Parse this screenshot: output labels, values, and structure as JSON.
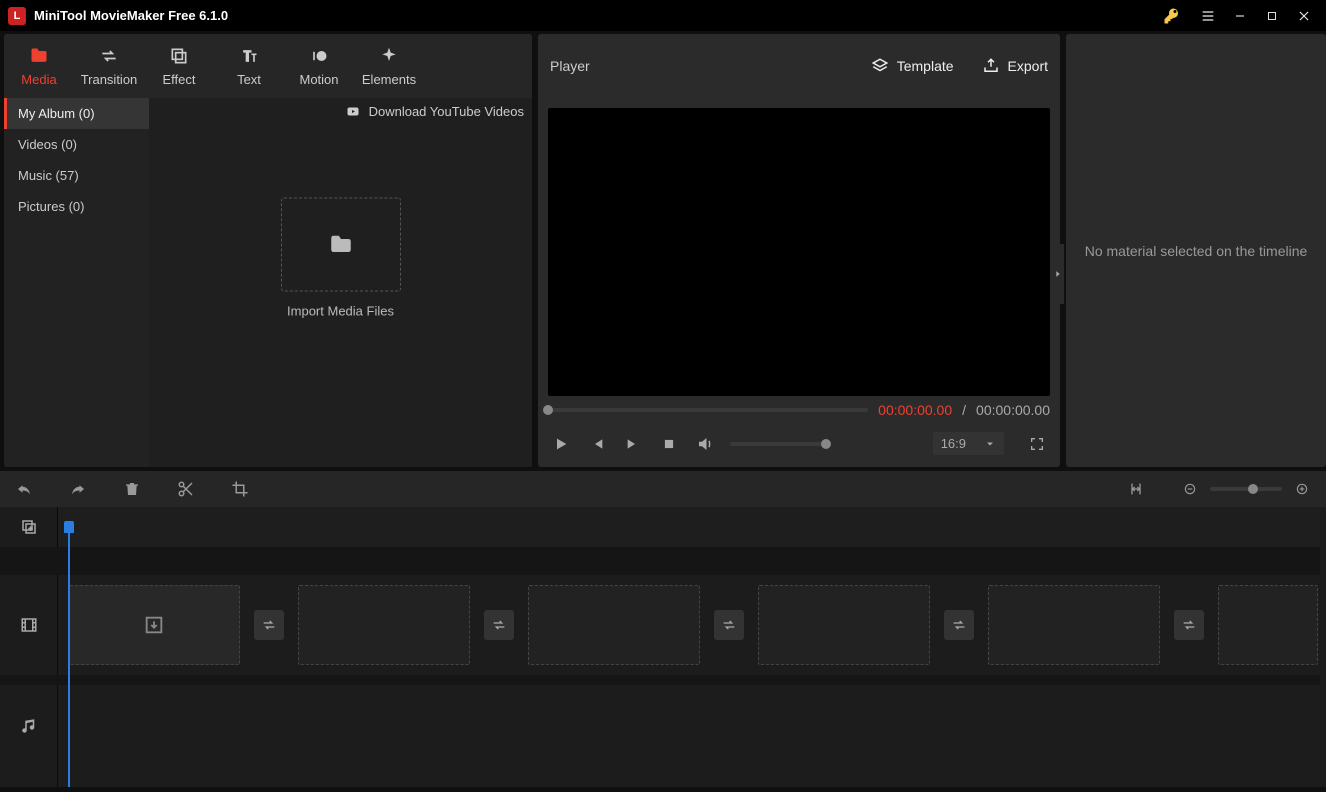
{
  "app": {
    "title": "MiniTool MovieMaker Free 6.1.0"
  },
  "tabs": {
    "media": "Media",
    "transition": "Transition",
    "effect": "Effect",
    "text": "Text",
    "motion": "Motion",
    "elements": "Elements"
  },
  "sidebar": {
    "items": [
      {
        "label": "My Album (0)"
      },
      {
        "label": "Videos (0)"
      },
      {
        "label": "Music (57)"
      },
      {
        "label": "Pictures (0)"
      }
    ]
  },
  "media": {
    "download_youtube": "Download YouTube Videos",
    "import_label": "Import Media Files"
  },
  "player": {
    "heading": "Player",
    "template": "Template",
    "export": "Export",
    "current_time": "00:00:00.00",
    "total_time": "00:00:00.00",
    "separator": " / ",
    "aspect": "16:9"
  },
  "properties": {
    "empty_msg": "No material selected on the timeline"
  }
}
